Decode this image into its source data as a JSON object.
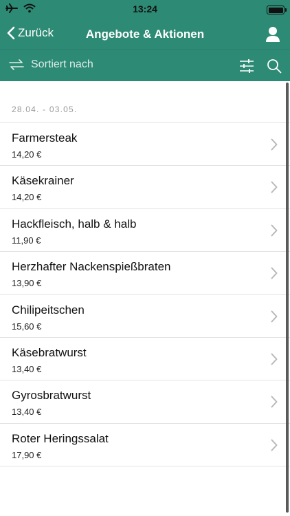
{
  "status_bar": {
    "time": "13:24"
  },
  "nav": {
    "back_label": "Zurück",
    "title": "Angebote & Aktionen"
  },
  "toolbar": {
    "sort_label": "Sortiert nach"
  },
  "section": {
    "date_range": "28.04. - 03.05."
  },
  "offers": [
    {
      "name": "Farmersteak",
      "price": "14,20 €"
    },
    {
      "name": "Käsekrainer",
      "price": "14,20 €"
    },
    {
      "name": "Hackfleisch, halb & halb",
      "price": "11,90 €"
    },
    {
      "name": "Herzhafter Nackenspießbraten",
      "price": "13,90 €"
    },
    {
      "name": "Chilipeitschen",
      "price": "15,60 €"
    },
    {
      "name": "Käsebratwurst",
      "price": "13,40 €"
    },
    {
      "name": "Gyrosbratwurst",
      "price": "13,40 €"
    },
    {
      "name": "Roter Heringssalat",
      "price": "17,90 €"
    }
  ],
  "colors": {
    "accent": "#2d8a74",
    "chevron": "#b8b8b8"
  },
  "icons": [
    "airplane-icon",
    "wifi-icon",
    "battery-icon",
    "chevron-left-icon",
    "user-icon",
    "swap-arrows-icon",
    "sliders-icon",
    "search-icon",
    "chevron-right-icon"
  ]
}
